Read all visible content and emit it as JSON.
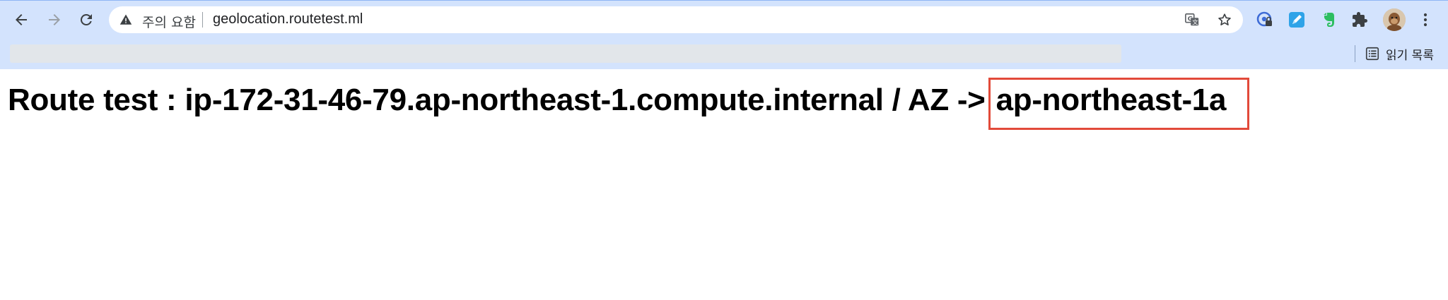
{
  "browser": {
    "address_bar": {
      "security_label": "주의 요함",
      "url": "geolocation.routetest.ml"
    },
    "bookmarks_bar": {
      "reading_list_label": "읽기 목록"
    },
    "icons": {
      "back": "arrow-left-icon",
      "forward": "arrow-right-icon",
      "reload": "reload-icon",
      "warning": "warning-triangle-icon",
      "translate": "translate-icon",
      "bookmark": "star-icon",
      "extensions": [
        "password-extension-icon",
        "pen-extension-icon",
        "evernote-extension-icon",
        "puzzle-extensions-icon"
      ],
      "menu": "kebab-menu-icon",
      "reading_list": "reading-list-icon"
    },
    "colors": {
      "chrome_bg": "#d3e3fd",
      "highlight_box": "#e24a3a"
    }
  },
  "page": {
    "route_prefix": "Route test : ip-172-31-46-79.ap-northeast-1.compute.internal / AZ ->",
    "az_value": "ap-northeast-1a"
  }
}
